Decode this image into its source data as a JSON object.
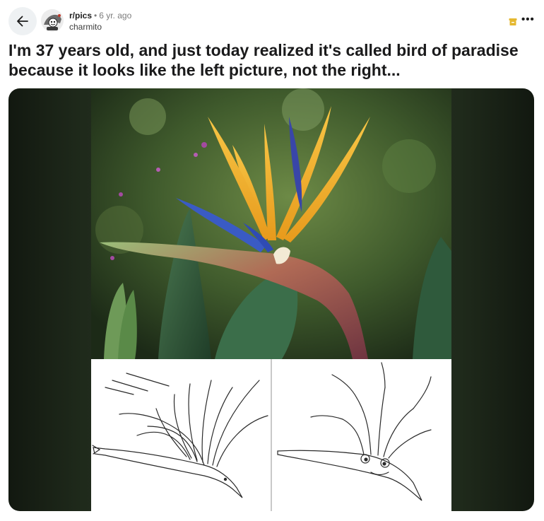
{
  "post": {
    "subreddit": "r/pics",
    "separator": "•",
    "age": "6 yr. ago",
    "author": "charmito",
    "title": "I'm 37 years old, and just today realized it's called bird of paradise because it looks like the left picture, not the right..."
  },
  "header": {
    "back_icon": "arrow-left-icon",
    "more_label": "•••",
    "badge_icon": "archive-icon"
  },
  "colors": {
    "badge": "#e5b830",
    "back_bg": "#eef1f3"
  }
}
